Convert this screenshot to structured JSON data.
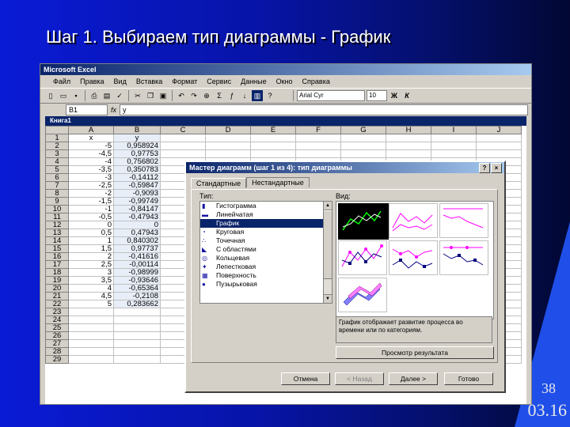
{
  "slide": {
    "title": "Шаг 1. Выбираем тип диаграммы  - График",
    "number": "38",
    "date": "03.16"
  },
  "excel": {
    "title": "Microsoft Excel",
    "menu": [
      "Файл",
      "Правка",
      "Вид",
      "Вставка",
      "Формат",
      "Сервис",
      "Данные",
      "Окно",
      "Справка"
    ],
    "font_name": "Arial Cyr",
    "font_size": "10",
    "bold_label": "Ж",
    "italic_label": "К",
    "namebox": "B1",
    "fx_label": "fx",
    "formula": "y",
    "workbook_title": "Книга1",
    "columns": [
      "A",
      "B",
      "C",
      "D",
      "E",
      "F",
      "G",
      "H",
      "I",
      "J"
    ],
    "rows": [
      [
        "1",
        "x",
        "y"
      ],
      [
        "2",
        "-5",
        "0,958924"
      ],
      [
        "3",
        "-4,5",
        "0,97753"
      ],
      [
        "4",
        "-4",
        "0,756802"
      ],
      [
        "5",
        "-3,5",
        "0,350783"
      ],
      [
        "6",
        "-3",
        "-0,14112"
      ],
      [
        "7",
        "-2,5",
        "-0,59847"
      ],
      [
        "8",
        "-2",
        "-0,9093"
      ],
      [
        "9",
        "-1,5",
        "-0,99749"
      ],
      [
        "10",
        "-1",
        "-0,84147"
      ],
      [
        "11",
        "-0,5",
        "-0,47943"
      ],
      [
        "12",
        "0",
        "0"
      ],
      [
        "13",
        "0,5",
        "0,47943"
      ],
      [
        "14",
        "1",
        "0,840302"
      ],
      [
        "15",
        "1,5",
        "0,97737"
      ],
      [
        "16",
        "2",
        "-0,41616"
      ],
      [
        "17",
        "2,5",
        "-0,00114"
      ],
      [
        "18",
        "3",
        "-0,98999"
      ],
      [
        "19",
        "3,5",
        "-0,93646"
      ],
      [
        "20",
        "4",
        "-0,65364"
      ],
      [
        "21",
        "4,5",
        "-0,2108"
      ],
      [
        "22",
        "5",
        "0,283662"
      ],
      [
        "23",
        "",
        ""
      ],
      [
        "24",
        "",
        ""
      ],
      [
        "25",
        "",
        ""
      ],
      [
        "26",
        "",
        ""
      ],
      [
        "27",
        "",
        ""
      ],
      [
        "28",
        "",
        ""
      ],
      [
        "29",
        "",
        ""
      ]
    ]
  },
  "dialog": {
    "title": "Мастер диаграмм (шаг 1 из 4): тип диаграммы",
    "help": "?",
    "close": "×",
    "tabs": [
      "Стандартные",
      "Нестандартные"
    ],
    "type_label": "Тип:",
    "view_label": "Вид:",
    "types": [
      "Гистограмма",
      "Линейчатая",
      "График",
      "Круговая",
      "Точечная",
      "С областями",
      "Кольцевая",
      "Лепестковая",
      "Поверхность",
      "Пузырьковая"
    ],
    "selected_type": "График",
    "description": "График отображает развитие процесса во времени или по категориям.",
    "preview_button": "Просмотр результата",
    "cancel_button": "Отмена",
    "back_button": "< Назад",
    "next_button": "Далее >",
    "finish_button": "Готово"
  },
  "colors": {
    "accent": "#0a246a",
    "chart_line": "#ff00ff",
    "chart_line2": "#000080"
  }
}
